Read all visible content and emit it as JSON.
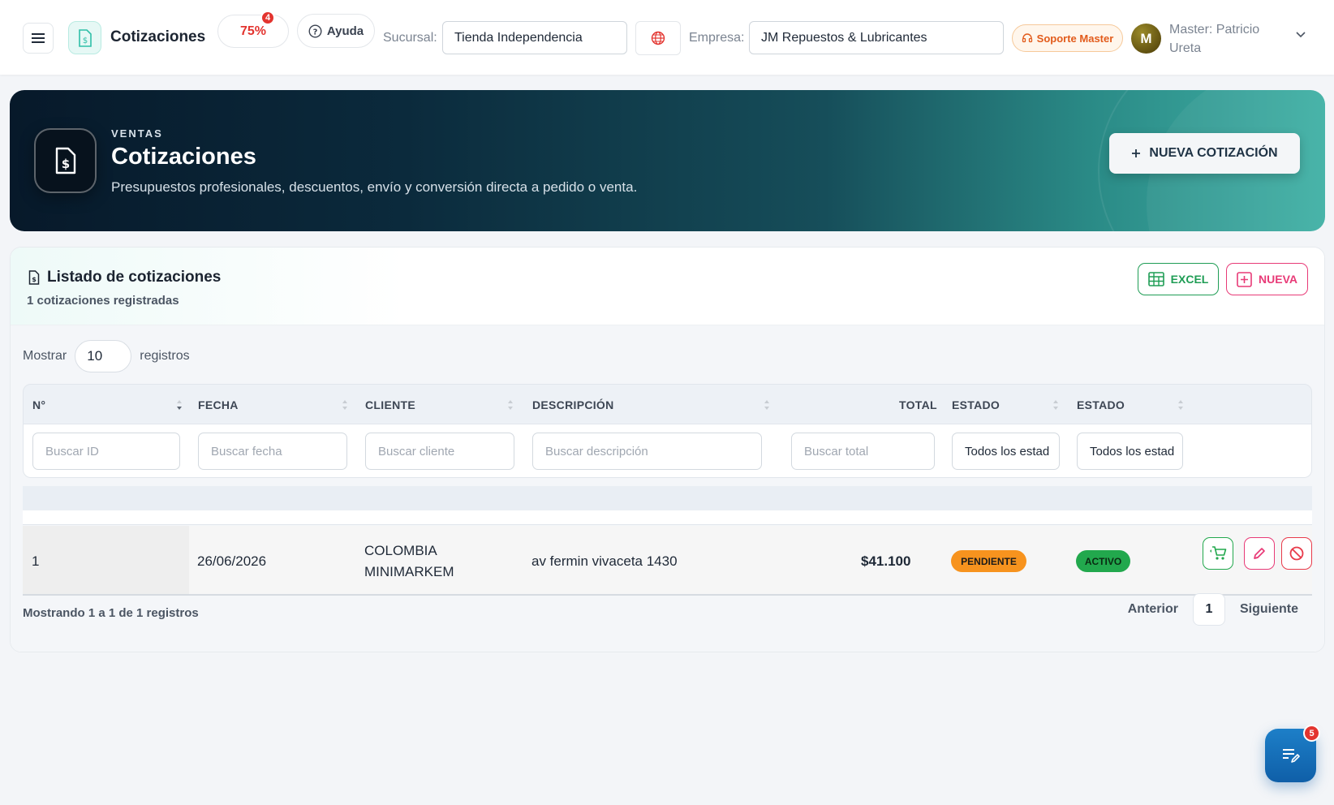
{
  "topbar": {
    "app_title": "Cotizaciones",
    "progress": "75%",
    "progress_badge": "4",
    "help_label": "Ayuda",
    "sucursal_label": "Sucursal:",
    "sucursal_value": "Tienda Independencia",
    "empresa_label": "Empresa:",
    "empresa_value": "JM Repuestos & Lubricantes",
    "support_label": "Soporte Master",
    "avatar_initial": "M",
    "user_name": "Master: Patricio Ureta"
  },
  "hero": {
    "eyebrow": "VENTAS",
    "title": "Cotizaciones",
    "subtitle": "Presupuestos profesionales, descuentos, envío y conversión directa a pedido o venta.",
    "new_button": "NUEVA COTIZACIÓN"
  },
  "card": {
    "title": "Listado de cotizaciones",
    "subtitle": "1 cotizaciones registradas",
    "excel_button": "EXCEL",
    "new_button": "NUEVA",
    "show_label": "Mostrar",
    "page_length": "10",
    "records_label": "registros"
  },
  "table": {
    "headers": [
      "N°",
      "FECHA",
      "CLIENTE",
      "DESCRIPCIÓN",
      "TOTAL",
      "ESTADO",
      "ESTADO"
    ],
    "filters": {
      "id_placeholder": "Buscar ID",
      "date_placeholder": "Buscar fecha",
      "client_placeholder": "Buscar cliente",
      "desc_placeholder": "Buscar descripción",
      "total_placeholder": "Buscar total",
      "status1_value": "Todos los estad",
      "status2_value": "Todos los estad"
    },
    "rows": [
      {
        "id": "1",
        "date": "26/06/2026",
        "client_line1": "COLOMBIA",
        "client_line2": "MINIMARKEM",
        "description": "av fermin vivaceta 1430",
        "total": "$41.100",
        "status": "PENDIENTE",
        "state": "ACTIVO"
      }
    ]
  },
  "footer": {
    "info": "Mostrando 1 a 1 de 1 registros",
    "prev": "Anterior",
    "page": "1",
    "next": "Siguiente"
  },
  "fab": {
    "badge": "5"
  },
  "colors": {
    "accent_teal": "#2a8a86",
    "danger": "#e3342f",
    "excel_green": "#1f9d55",
    "nueva_pink": "#e83a77",
    "pending_orange": "#f7931e",
    "active_green": "#22a84d",
    "fab_blue": "#1d7fc8"
  },
  "icons": [
    "menu-icon",
    "document-dollar-icon",
    "help-circle-icon",
    "globe-icon",
    "headset-icon",
    "chevron-down-icon",
    "plus-icon",
    "spreadsheet-icon",
    "plus-square-icon",
    "sort-icon",
    "cart-icon",
    "pencil-icon",
    "ban-icon",
    "notes-edit-icon"
  ]
}
